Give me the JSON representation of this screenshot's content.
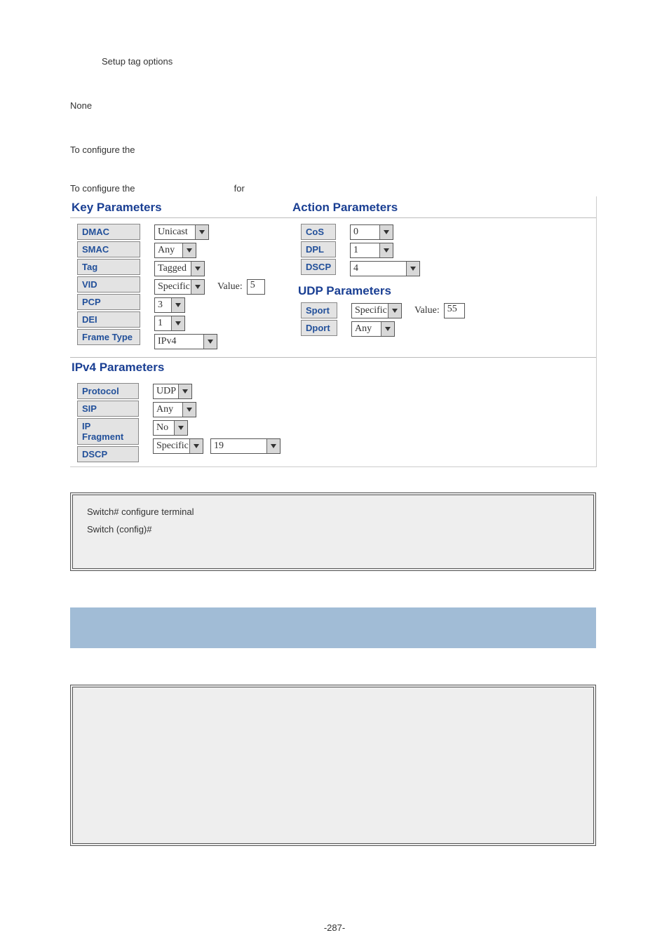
{
  "text": {
    "setup_tag": "Setup tag options",
    "none": "None",
    "to_conf_1": "To configure the",
    "to_conf_2a": "To configure the",
    "to_conf_2b": "for",
    "page_num": "-287-"
  },
  "key": {
    "heading": "Key Parameters",
    "labels": {
      "dmac": "DMAC",
      "smac": "SMAC",
      "tag": "Tag",
      "vid": "VID",
      "pcp": "PCP",
      "dei": "DEI",
      "frame": "Frame Type"
    },
    "values": {
      "dmac": "Unicast",
      "smac": "Any",
      "tag": "Tagged",
      "vid": "Specific",
      "vid_value_label": "Value:",
      "vid_value": "5",
      "pcp": "3",
      "dei": "1",
      "frame": "IPv4"
    }
  },
  "action": {
    "heading": "Action Parameters",
    "labels": {
      "cos": "CoS",
      "dpl": "DPL",
      "dscp": "DSCP"
    },
    "values": {
      "cos": "0",
      "dpl": "1",
      "dscp": "4"
    }
  },
  "udp": {
    "heading": "UDP Parameters",
    "labels": {
      "sport": "Sport",
      "dport": "Dport"
    },
    "values": {
      "sport": "Specific",
      "sport_value_label": "Value:",
      "sport_value": "55",
      "dport": "Any"
    }
  },
  "ipv4": {
    "heading": "IPv4 Parameters",
    "labels": {
      "protocol": "Protocol",
      "sip": "SIP",
      "ipfrag": "IP Fragment",
      "dscp": "DSCP"
    },
    "values": {
      "protocol": "UDP",
      "sip": "Any",
      "ipfrag": "No",
      "dscp": "Specific",
      "dscp_val": "19"
    }
  },
  "code": {
    "l1": "Switch# configure terminal",
    "l2": "Switch (config)#"
  }
}
